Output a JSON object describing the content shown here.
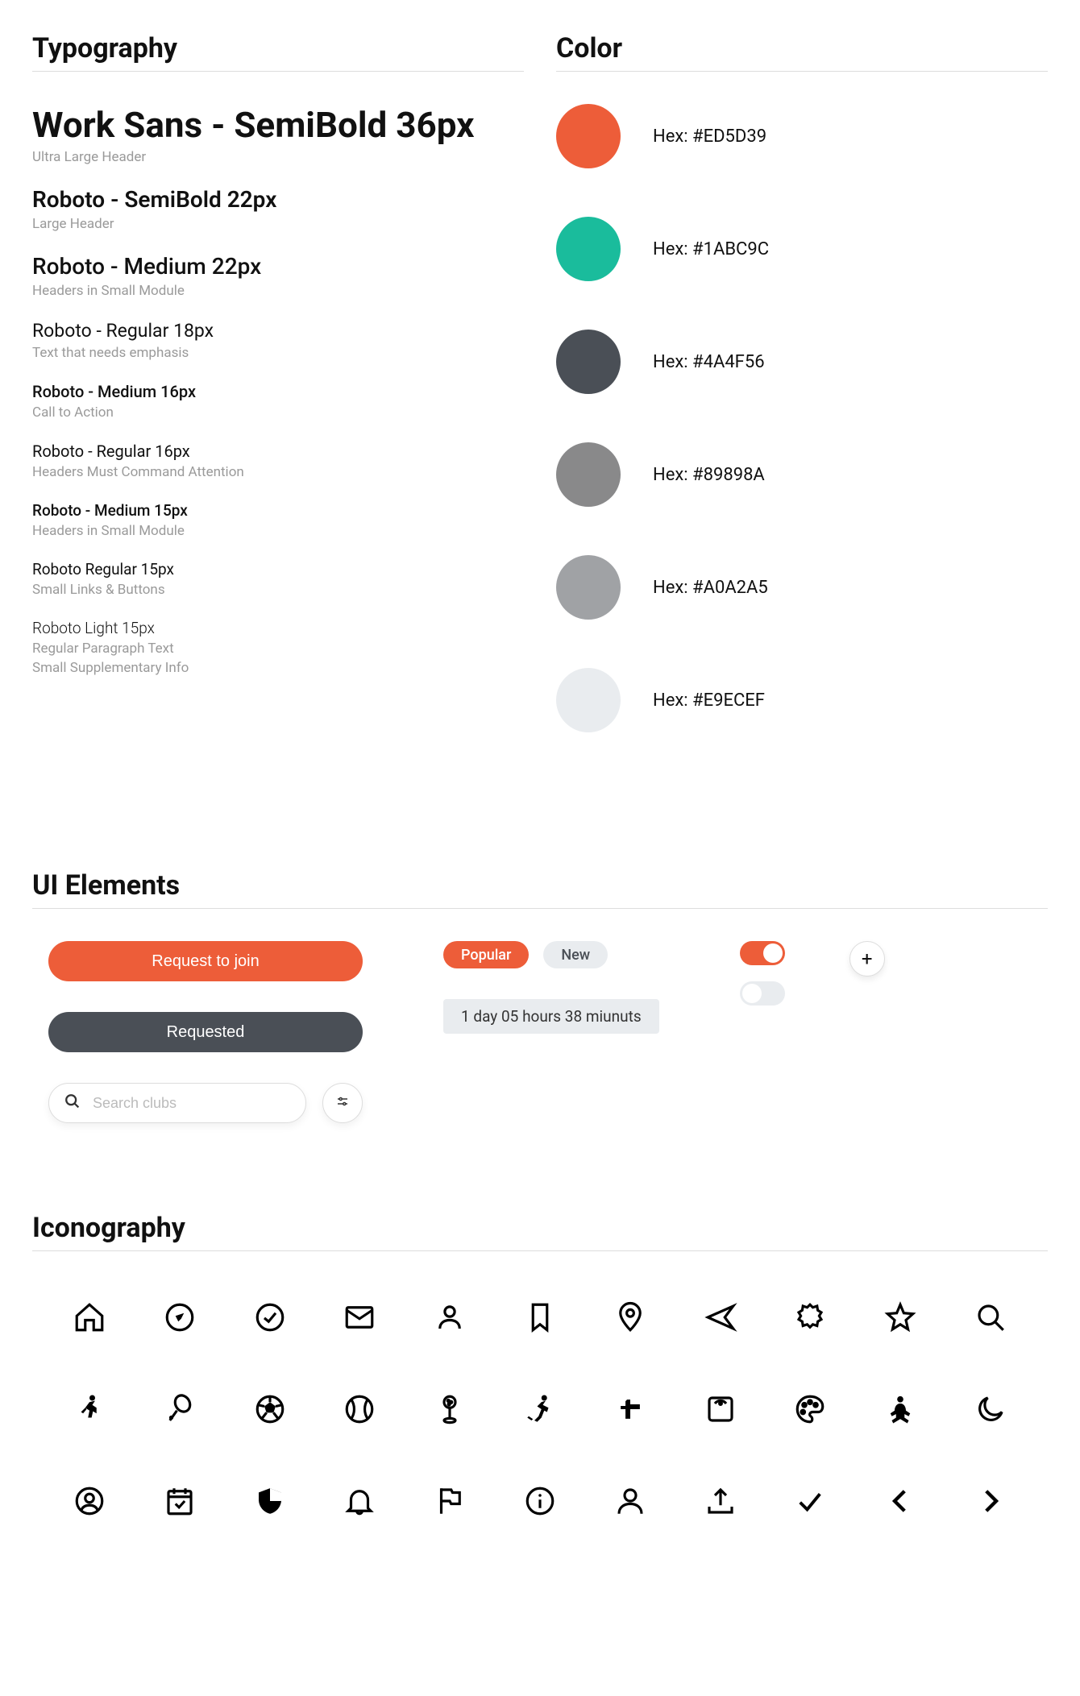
{
  "sections": {
    "typography": "Typography",
    "color": "Color",
    "ui": "UI Elements",
    "iconography": "Iconography"
  },
  "typography": [
    {
      "sample": "Work Sans - SemiBold 36px",
      "desc": "Ultra Large Header"
    },
    {
      "sample": "Roboto - SemiBold 22px",
      "desc": "Large Header"
    },
    {
      "sample": "Roboto - Medium 22px",
      "desc": "Headers in Small Module"
    },
    {
      "sample": "Roboto - Regular 18px",
      "desc": "Text that needs emphasis"
    },
    {
      "sample": "Roboto - Medium 16px",
      "desc": "Call to Action"
    },
    {
      "sample": "Roboto - Regular 16px",
      "desc": "Headers Must Command Attention"
    },
    {
      "sample": "Roboto - Medium 15px",
      "desc": "Headers in Small Module"
    },
    {
      "sample": "Roboto Regular 15px",
      "desc": "Small Links & Buttons"
    },
    {
      "sample": "Roboto Light 15px",
      "desc": "Regular Paragraph Text",
      "desc2": "Small Supplementary Info"
    }
  ],
  "colors": [
    {
      "hex": "#ED5D39",
      "label": "Hex: #ED5D39"
    },
    {
      "hex": "#1ABC9C",
      "label": "Hex: #1ABC9C"
    },
    {
      "hex": "#4A4F56",
      "label": "Hex: #4A4F56"
    },
    {
      "hex": "#89898A",
      "label": "Hex: #89898A"
    },
    {
      "hex": "#A0A2A5",
      "label": "Hex: #A0A2A5"
    },
    {
      "hex": "#E9ECEF",
      "label": "Hex: #E9ECEF"
    }
  ],
  "ui": {
    "request_btn": "Request to join",
    "requested_btn": "Requested",
    "search_placeholder": "Search clubs",
    "chip_popular": "Popular",
    "chip_new": "New",
    "time_chip": "1 day 05 hours 38 miunuts"
  },
  "icons": {
    "row1": [
      "home",
      "compass",
      "check-circle",
      "mail",
      "person",
      "bookmark",
      "location-pin",
      "send",
      "badge",
      "star",
      "search"
    ],
    "row2": [
      "running",
      "tennis",
      "soccer",
      "baseball",
      "golf",
      "skiing",
      "dumbbell",
      "scale",
      "palette",
      "meditation",
      "moon"
    ],
    "row3": [
      "account-circle",
      "calendar-check",
      "shield",
      "bell",
      "flag",
      "info",
      "user",
      "upload",
      "check",
      "chevron-left",
      "chevron-right"
    ]
  }
}
